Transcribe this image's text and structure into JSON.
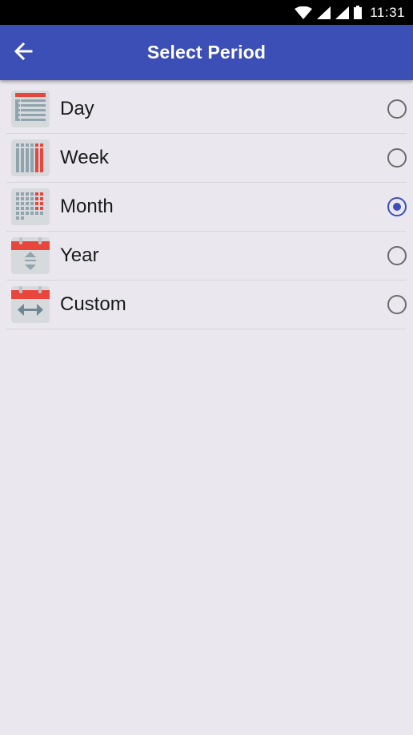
{
  "status_bar": {
    "time": "11:31",
    "icons": [
      "wifi-icon",
      "signal-icon",
      "signal-icon",
      "battery-icon"
    ]
  },
  "app_bar": {
    "back_icon": "arrow-back-icon",
    "title": "Select Period"
  },
  "periods": [
    {
      "label": "Day",
      "icon": "calendar-day-icon",
      "selected": false
    },
    {
      "label": "Week",
      "icon": "calendar-week-icon",
      "selected": false
    },
    {
      "label": "Month",
      "icon": "calendar-month-icon",
      "selected": true
    },
    {
      "label": "Year",
      "icon": "calendar-year-icon",
      "selected": false
    },
    {
      "label": "Custom",
      "icon": "calendar-custom-icon",
      "selected": false
    }
  ],
  "colors": {
    "primary": "#3c4fb7",
    "accent_red": "#e8453c",
    "icon_gray": "#8fa4ad",
    "background": "#eae8ee"
  }
}
